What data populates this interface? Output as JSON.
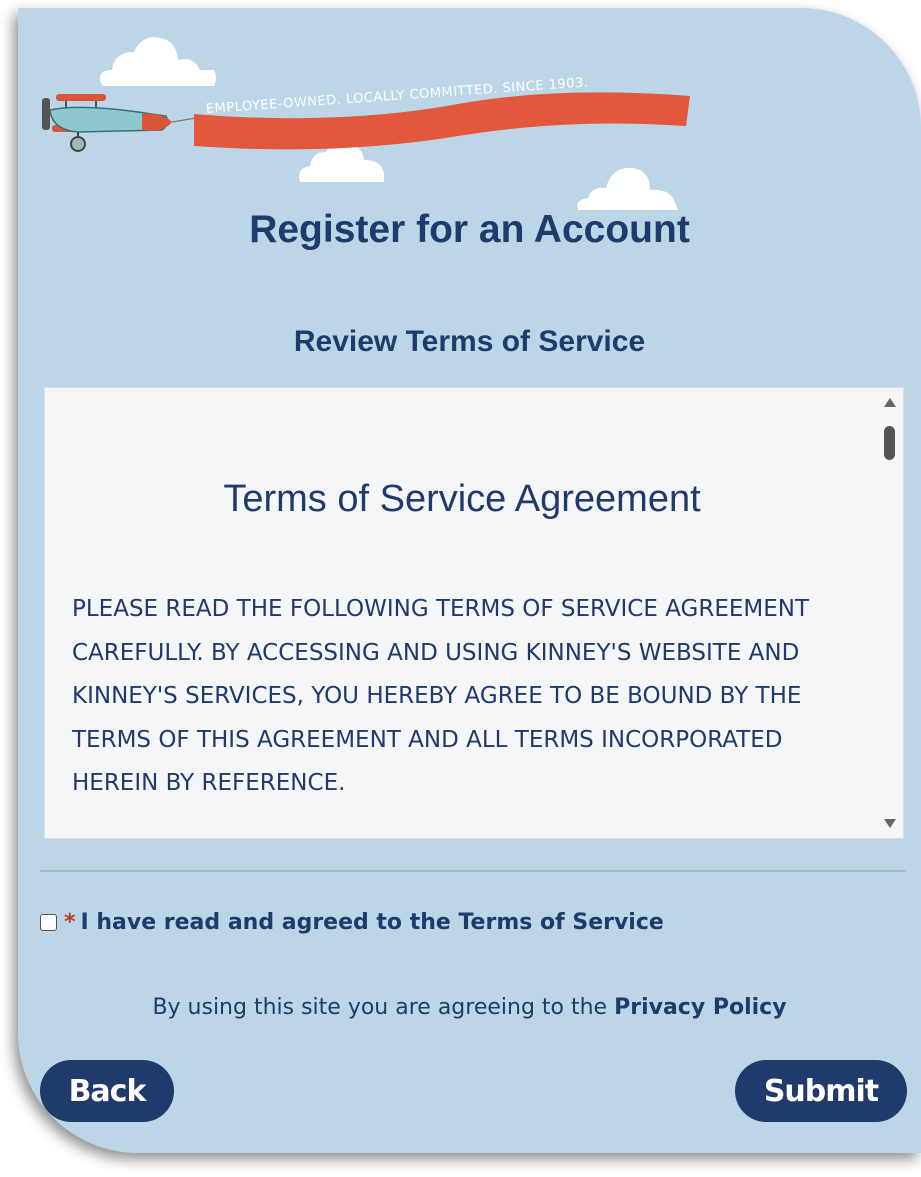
{
  "banner": {
    "slogan": "EMPLOYEE-OWNED. LOCALLY COMMITTED. SINCE 1903."
  },
  "page": {
    "title": "Register for an Account",
    "subtitle": "Review Terms of Service"
  },
  "tos": {
    "heading": "Terms of Service Agreement",
    "body": "PLEASE READ THE FOLLOWING TERMS OF SERVICE AGREEMENT CAREFULLY. BY ACCESSING AND USING KINNEY'S WEBSITE AND KINNEY'S SERVICES, YOU HEREBY AGREE TO BE BOUND BY THE TERMS OF THIS AGREEMENT AND ALL TERMS INCORPORATED HEREIN BY REFERENCE."
  },
  "agreement": {
    "required_mark": "*",
    "label": "I have read and agreed to the Terms of Service",
    "checked": false
  },
  "privacy": {
    "prefix": "By using this site you are agreeing to the",
    "link": "Privacy Policy"
  },
  "buttons": {
    "back": "Back",
    "submit": "Submit"
  },
  "icons": {
    "plane": "biplane-icon",
    "cloud": "cloud-icon",
    "scroll_up": "chevron-up-icon",
    "scroll_down": "chevron-down-icon"
  },
  "colors": {
    "background": "#bcd6e7",
    "primary": "#1f3a6b",
    "banner": "#e2583c",
    "required": "#c0392b"
  }
}
